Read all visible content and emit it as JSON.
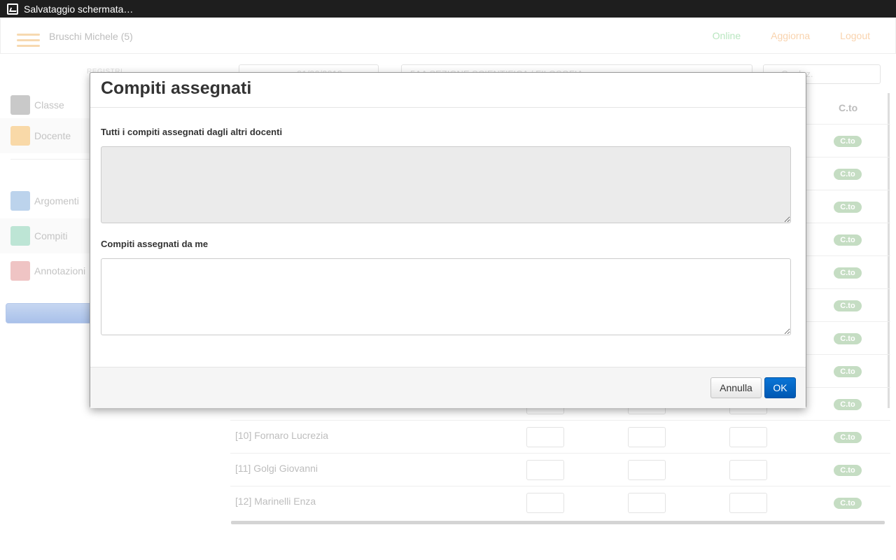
{
  "system_bar": {
    "title": "Salvataggio schermata…",
    "icon": "screenshot-icon"
  },
  "header": {
    "user": "Bruschi Michele (5)",
    "nav": {
      "online": "Online",
      "aggiorna": "Aggiorna",
      "logout": "Logout"
    }
  },
  "filters": {
    "registri_label": "REGISTRI",
    "date": "01/06/2019",
    "subject": "5AA SEZIONE SCIENTIFICA / FILOSOFIA",
    "ora_placeholder": "Ora lez."
  },
  "sidebar": {
    "items": [
      {
        "label": "Classe",
        "icon": "class-icon",
        "color": "#c7c7c7"
      },
      {
        "label": "Docente",
        "icon": "teacher-icon",
        "color": "#f9d9a8"
      },
      {
        "label": "Argomenti",
        "icon": "topics-icon",
        "color": "#bcd3ec"
      },
      {
        "label": "Compiti",
        "icon": "homework-icon",
        "color": "#bde5d5"
      },
      {
        "label": "Annotazioni",
        "icon": "notes-icon",
        "color": "#efc4c4"
      }
    ]
  },
  "table": {
    "column_cto": "C.to",
    "badge": "C.to",
    "visible_students": [
      "[10] Fornaro Lucrezia",
      "[11] Golgi Giovanni",
      "[12] Marinelli Enza"
    ]
  },
  "modal": {
    "title": "Compiti assegnati",
    "label_others": "Tutti i compiti assegnati dagli altri docenti",
    "value_others": "",
    "label_mine": "Compiti assegnati da me",
    "value_mine": "",
    "cancel_label": "Annulla",
    "ok_label": "OK"
  }
}
